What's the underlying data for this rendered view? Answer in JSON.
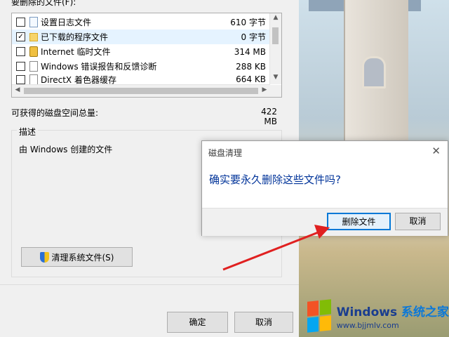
{
  "main_dialog": {
    "files_label": "要删除的文件(F):",
    "files": [
      {
        "name": "设置日志文件",
        "size": "610 字节",
        "checked": false,
        "icon": "document-icon"
      },
      {
        "name": "已下载的程序文件",
        "size": "0 字节",
        "checked": true,
        "icon": "folder-icon"
      },
      {
        "name": "Internet 临时文件",
        "size": "314 MB",
        "checked": false,
        "icon": "lock-icon"
      },
      {
        "name": "Windows 错误报告和反馈诊断",
        "size": "288 KB",
        "checked": false,
        "icon": "document-icon"
      },
      {
        "name": "DirectX 着色器缓存",
        "size": "664 KB",
        "checked": false,
        "icon": "document-icon"
      }
    ],
    "space_label": "可获得的磁盘空间总量:",
    "space_value": "422 MB",
    "description_title": "描述",
    "description_text": "由 Windows 创建的文件",
    "clean_system_button": "清理系统文件(S)",
    "ok_button": "确定",
    "cancel_button": "取消"
  },
  "confirm_dialog": {
    "title": "磁盘清理",
    "message": "确实要永久删除这些文件吗?",
    "delete_button": "删除文件",
    "cancel_button": "取消"
  },
  "watermark": {
    "brand": "Windows",
    "brand_suffix": "系统之家",
    "url": "www.bjjmlv.com"
  },
  "colors": {
    "accent": "#0078d7",
    "arrow": "#e02020"
  }
}
